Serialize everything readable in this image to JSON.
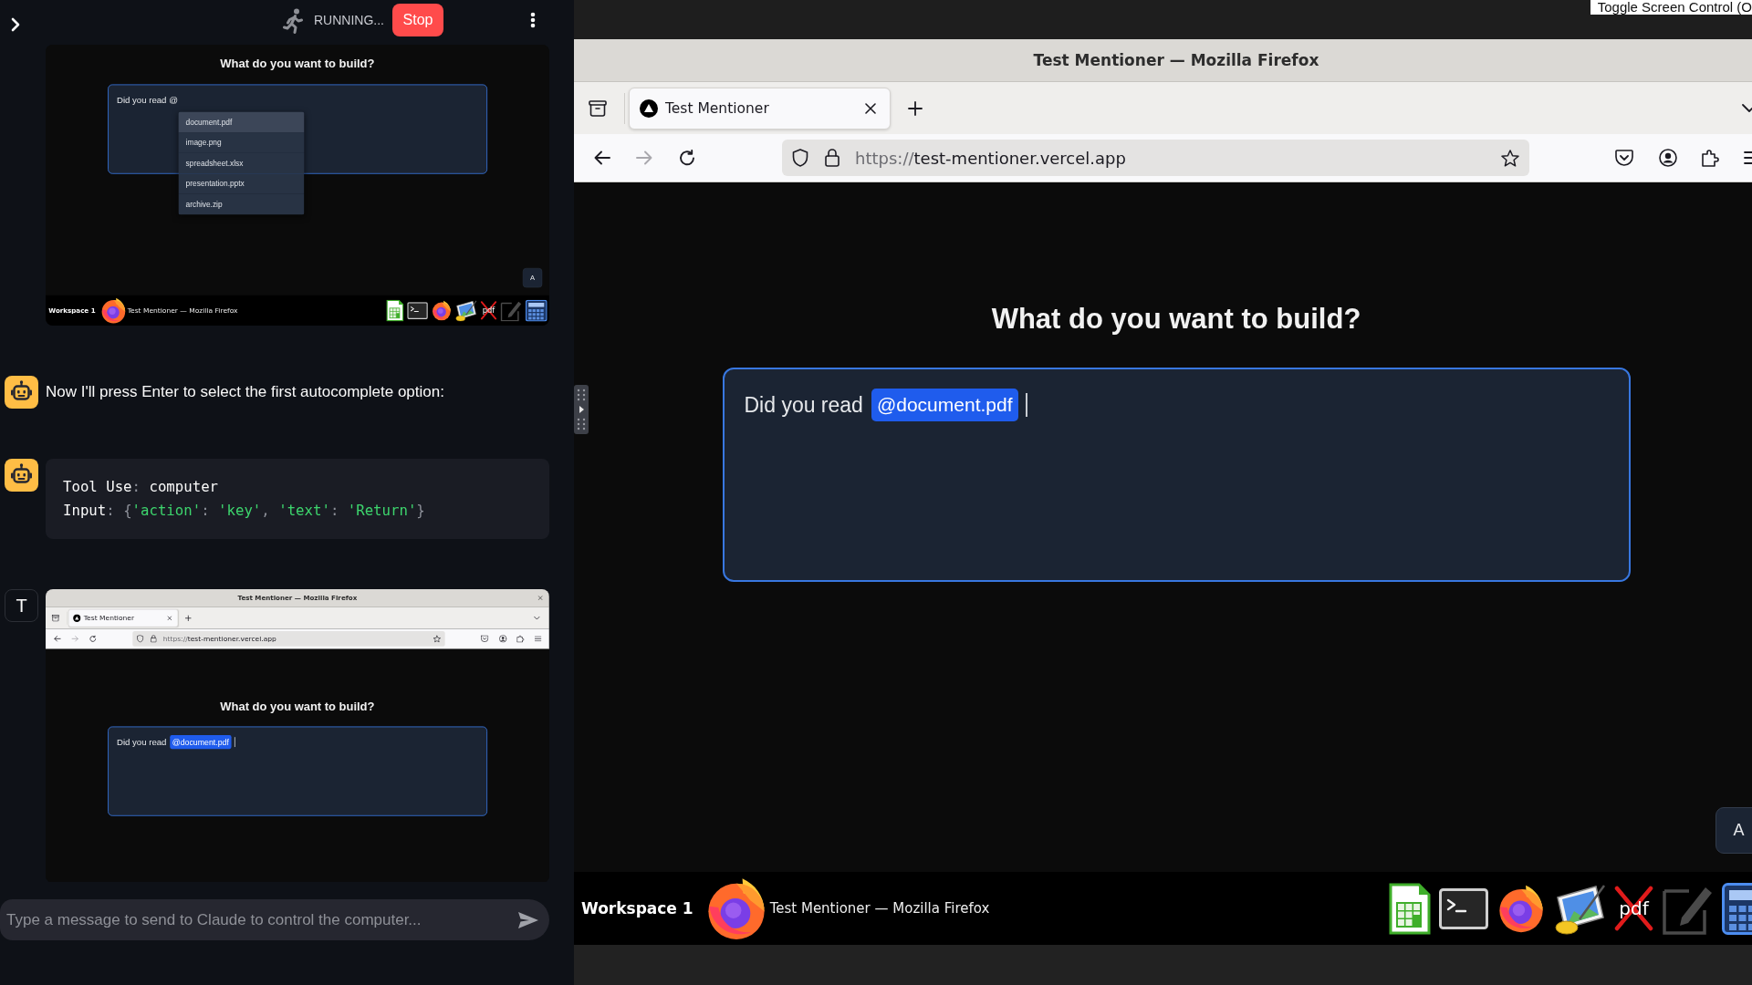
{
  "header": {
    "status": "RUNNING...",
    "stop_button": "Stop"
  },
  "messages": [
    {
      "kind": "screenshot",
      "screenshot": {
        "page": {
          "heading": "What do you want to build?",
          "editor": {
            "text": "Did you read @",
            "caret": false
          },
          "dropdown": [
            {
              "label": "document.pdf",
              "selected": true
            },
            {
              "label": "image.png",
              "selected": false
            },
            {
              "label": "spreadsheet.xlsx",
              "selected": false
            },
            {
              "label": "presentation.pptx",
              "selected": false
            },
            {
              "label": "archive.zip",
              "selected": false
            }
          ],
          "corner_button": "A"
        },
        "taskbar": {
          "workspace": "Workspace 1",
          "window_title": "Test Mentioner — Mozilla Firefox",
          "launchers": [
            {
              "kind": "spreadsheet"
            },
            {
              "kind": "terminal"
            },
            {
              "kind": "browser"
            },
            {
              "kind": "image-viewer"
            },
            {
              "kind": "pdf",
              "label": "pdf"
            },
            {
              "kind": "editor"
            },
            {
              "kind": "calculator"
            }
          ]
        }
      }
    },
    {
      "kind": "text",
      "avatar": {
        "kind": "bot"
      },
      "text": "Now I'll press Enter to select the first autocomplete option:"
    },
    {
      "kind": "tool_use",
      "avatar": {
        "kind": "bot"
      },
      "code_lines": [
        "Tool Use: computer",
        "Input: {'action': 'key', 'text': 'Return'}"
      ]
    },
    {
      "kind": "screenshot",
      "avatar": {
        "kind": "letter",
        "text": "T"
      },
      "screenshot": {
        "browser": {
          "window_title": "Test Mentioner — Mozilla Firefox",
          "window_buttons": [
            {
              "kind": "close"
            }
          ],
          "tabs": [
            {
              "title": "Test Mentioner",
              "selected": true
            }
          ],
          "nav_buttons": [
            {
              "kind": "back",
              "disabled": false
            },
            {
              "kind": "forward",
              "disabled": true
            },
            {
              "kind": "reload",
              "disabled": false
            }
          ],
          "url": {
            "scheme": "https://",
            "rest": "test-mentioner.vercel.app"
          }
        },
        "page": {
          "heading": "What do you want to build?",
          "editor": {
            "text": "Did you read",
            "mention": "@document.pdf",
            "caret": true
          }
        }
      }
    }
  ],
  "chat_input": {
    "placeholder": "Type a message to send to Claude to control the computer..."
  },
  "screen_control_button": "Toggle Screen Control (O",
  "screen": {
    "browser": {
      "window_title": "Test Mentioner — Mozilla Firefox",
      "tabs": [
        {
          "title": "Test Mentioner",
          "selected": true
        }
      ],
      "nav_buttons": [
        {
          "kind": "back",
          "disabled": false
        },
        {
          "kind": "forward",
          "disabled": true
        },
        {
          "kind": "reload",
          "disabled": false
        }
      ],
      "url": {
        "scheme": "https://",
        "rest": "test-mentioner.vercel.app"
      }
    },
    "page": {
      "heading": "What do you want to build?",
      "editor": {
        "text": "Did you read",
        "mention": "@document.pdf",
        "caret": true
      },
      "corner_button": "A"
    },
    "taskbar": {
      "workspace": "Workspace 1",
      "window_title": "Test Mentioner — Mozilla Firefox",
      "launchers": [
        {
          "kind": "spreadsheet"
        },
        {
          "kind": "terminal"
        },
        {
          "kind": "browser"
        },
        {
          "kind": "image-viewer"
        },
        {
          "kind": "pdf",
          "label": "pdf"
        },
        {
          "kind": "editor"
        },
        {
          "kind": "calculator"
        }
      ]
    }
  }
}
